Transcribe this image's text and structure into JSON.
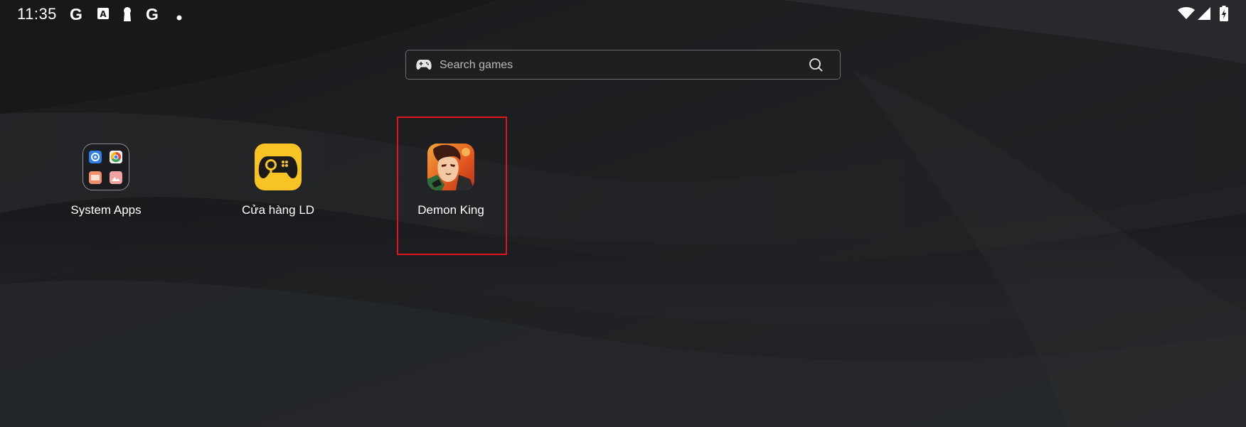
{
  "status_bar": {
    "time": "11:35",
    "icons": [
      "google-icon",
      "font-icon",
      "keyhole-icon",
      "google-icon",
      "dot-icon",
      "wifi-icon",
      "signal-icon",
      "battery-charging-icon"
    ]
  },
  "search": {
    "placeholder": "Search games",
    "icon_left": "gamepad-icon",
    "icon_right": "search-icon"
  },
  "apps": [
    {
      "label": "System Apps",
      "icon": "system-apps-folder-icon"
    },
    {
      "label": "Cửa hàng LD",
      "icon": "ld-store-gamepad-icon",
      "accent": "#f7c325"
    },
    {
      "label": "Demon King",
      "icon": "demon-king-game-icon",
      "highlighted": true
    }
  ],
  "colors": {
    "highlight": "#e0141c",
    "background": "#1b1c1e"
  }
}
